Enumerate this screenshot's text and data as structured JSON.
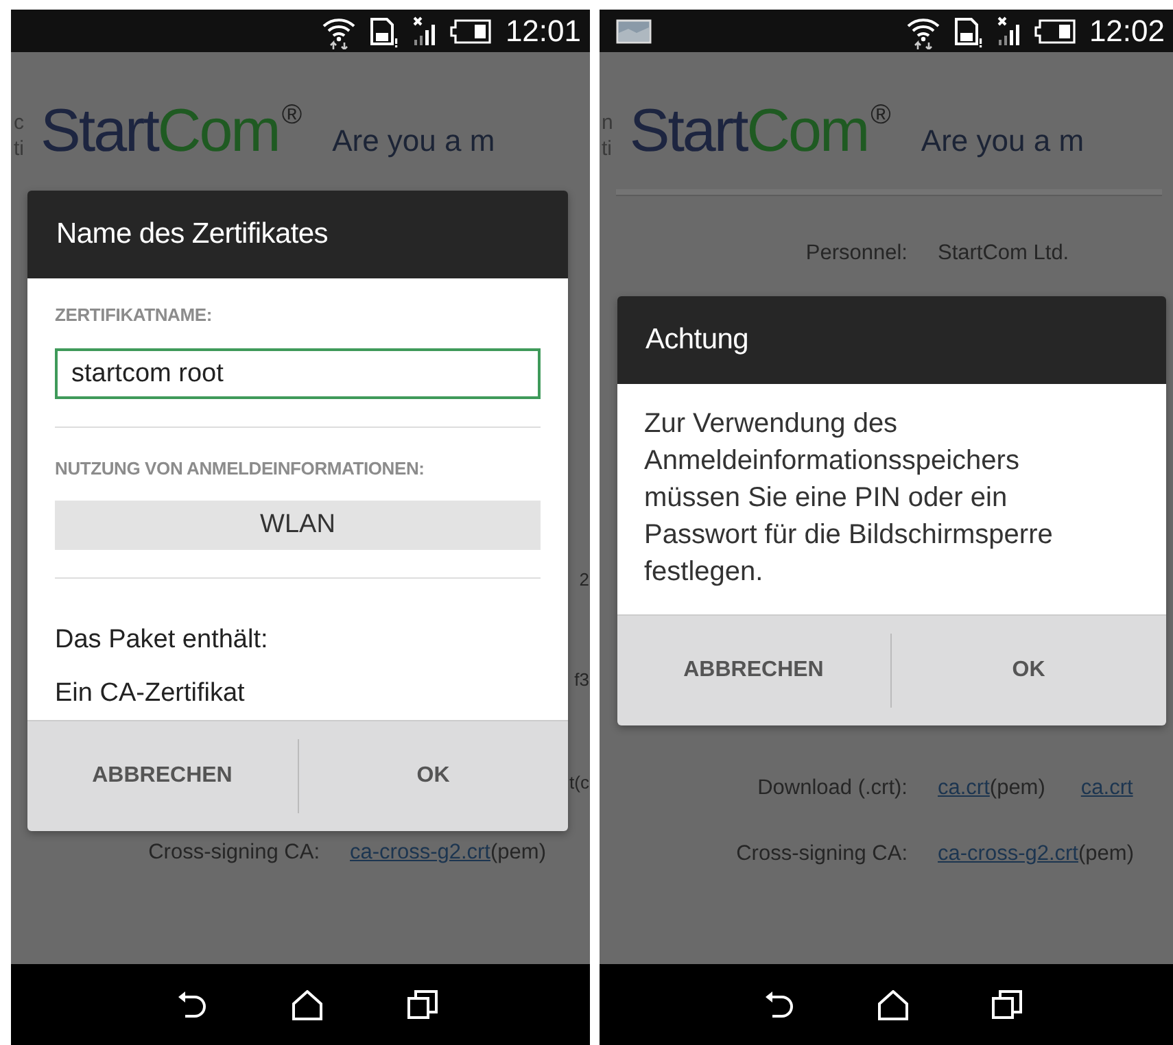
{
  "screens": [
    {
      "status_bar": {
        "image_notification": false,
        "time": "12:01"
      },
      "page": {
        "logo": {
          "part_1": "Start",
          "part_2": "Com",
          "mark": "®"
        },
        "tagline": "Are you a m",
        "edge_fragments": [
          "c",
          "ti"
        ],
        "rows": [
          {
            "kind": "fragment",
            "text": "2"
          },
          {
            "kind": "fragment",
            "text": "f3"
          },
          {
            "kind": "fragment",
            "text": "t(c"
          },
          {
            "kind": "field",
            "label": "Cross-signing CA:",
            "link": "ca-cross-g2.crt",
            "suffix": "(pem)"
          }
        ]
      },
      "dialog": {
        "title": "Name des Zertifikates",
        "body": [
          {
            "kind": "label",
            "text": "ZERTIFIKATNAME:"
          },
          {
            "kind": "input",
            "value": "startcom root",
            "focused": true
          },
          {
            "kind": "divider"
          },
          {
            "kind": "label",
            "text": "NUTZUNG VON ANMELDEINFORMATIONEN:"
          },
          {
            "kind": "select",
            "text": "WLAN"
          },
          {
            "kind": "divider"
          },
          {
            "kind": "text",
            "text": "Das Paket enthält:"
          },
          {
            "kind": "text",
            "text": "Ein CA-Zertifikat"
          }
        ],
        "buttons": [
          "ABBRECHEN",
          "OK"
        ]
      }
    },
    {
      "status_bar": {
        "image_notification": true,
        "time": "12:02"
      },
      "page": {
        "logo": {
          "part_1": "Start",
          "part_2": "Com",
          "mark": "®"
        },
        "tagline": "Are you a m",
        "edge_fragments": [
          "n",
          "ti"
        ],
        "rows": [
          {
            "kind": "field",
            "label": "Personnel:",
            "value": "StartCom Ltd."
          },
          {
            "kind": "field",
            "label": "Download (.crt):",
            "link": "ca.crt",
            "suffix": "(pem)",
            "link_2": "ca.crt"
          },
          {
            "kind": "field",
            "label": "Cross-signing CA:",
            "link": "ca-cross-g2.crt",
            "suffix": "(pem)"
          }
        ]
      },
      "dialog": {
        "title": "Achtung",
        "body": [
          {
            "kind": "message",
            "text": "Zur Verwendung des Anmeldeinformationsspeichers müssen Sie eine PIN oder ein Passwort für die Bildschirmsperre festlegen."
          }
        ],
        "buttons": [
          "ABBRECHEN",
          "OK"
        ]
      }
    }
  ]
}
